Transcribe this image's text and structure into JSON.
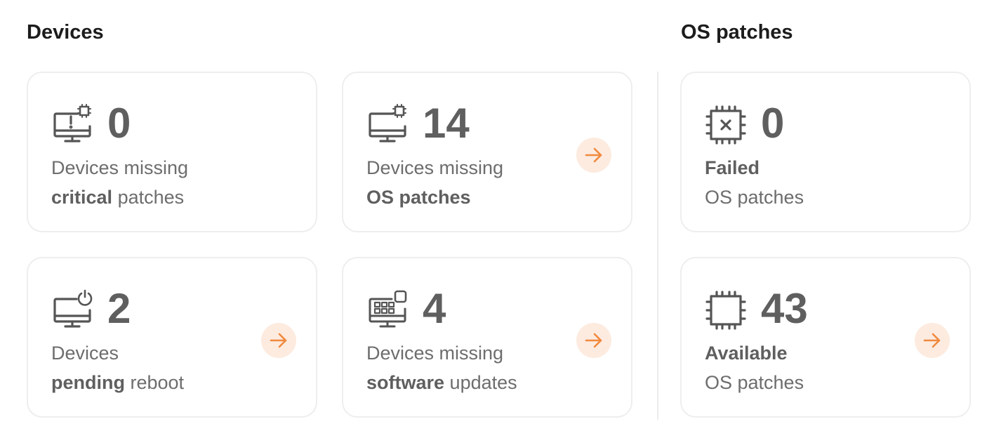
{
  "sections": {
    "devices_title": "Devices",
    "os_patches_title": "OS patches"
  },
  "cards": {
    "critical": {
      "count": "0",
      "line1": "Devices missing",
      "line2_bold": "critical",
      "line2_rest": " patches",
      "icon": "monitor-alert-icon"
    },
    "os_missing": {
      "count": "14",
      "line1": "Devices missing",
      "line2_bold": "OS patches",
      "line2_rest": "",
      "icon": "monitor-chip-icon"
    },
    "failed": {
      "count": "0",
      "line1_bold": "Failed",
      "line2": "OS patches",
      "icon": "chip-x-icon"
    },
    "reboot": {
      "count": "2",
      "line1": "Devices",
      "line2_bold": "pending",
      "line2_rest": " reboot",
      "icon": "monitor-power-icon"
    },
    "software": {
      "count": "4",
      "line1": "Devices missing",
      "line2_bold": "software",
      "line2_rest": " updates",
      "icon": "monitor-apps-icon"
    },
    "available": {
      "count": "43",
      "line1_bold": "Available",
      "line2": "OS patches",
      "icon": "chip-icon"
    }
  },
  "colors": {
    "accent": "#f08a3e",
    "accent_bg": "#fdebe0",
    "icon": "#555555"
  }
}
